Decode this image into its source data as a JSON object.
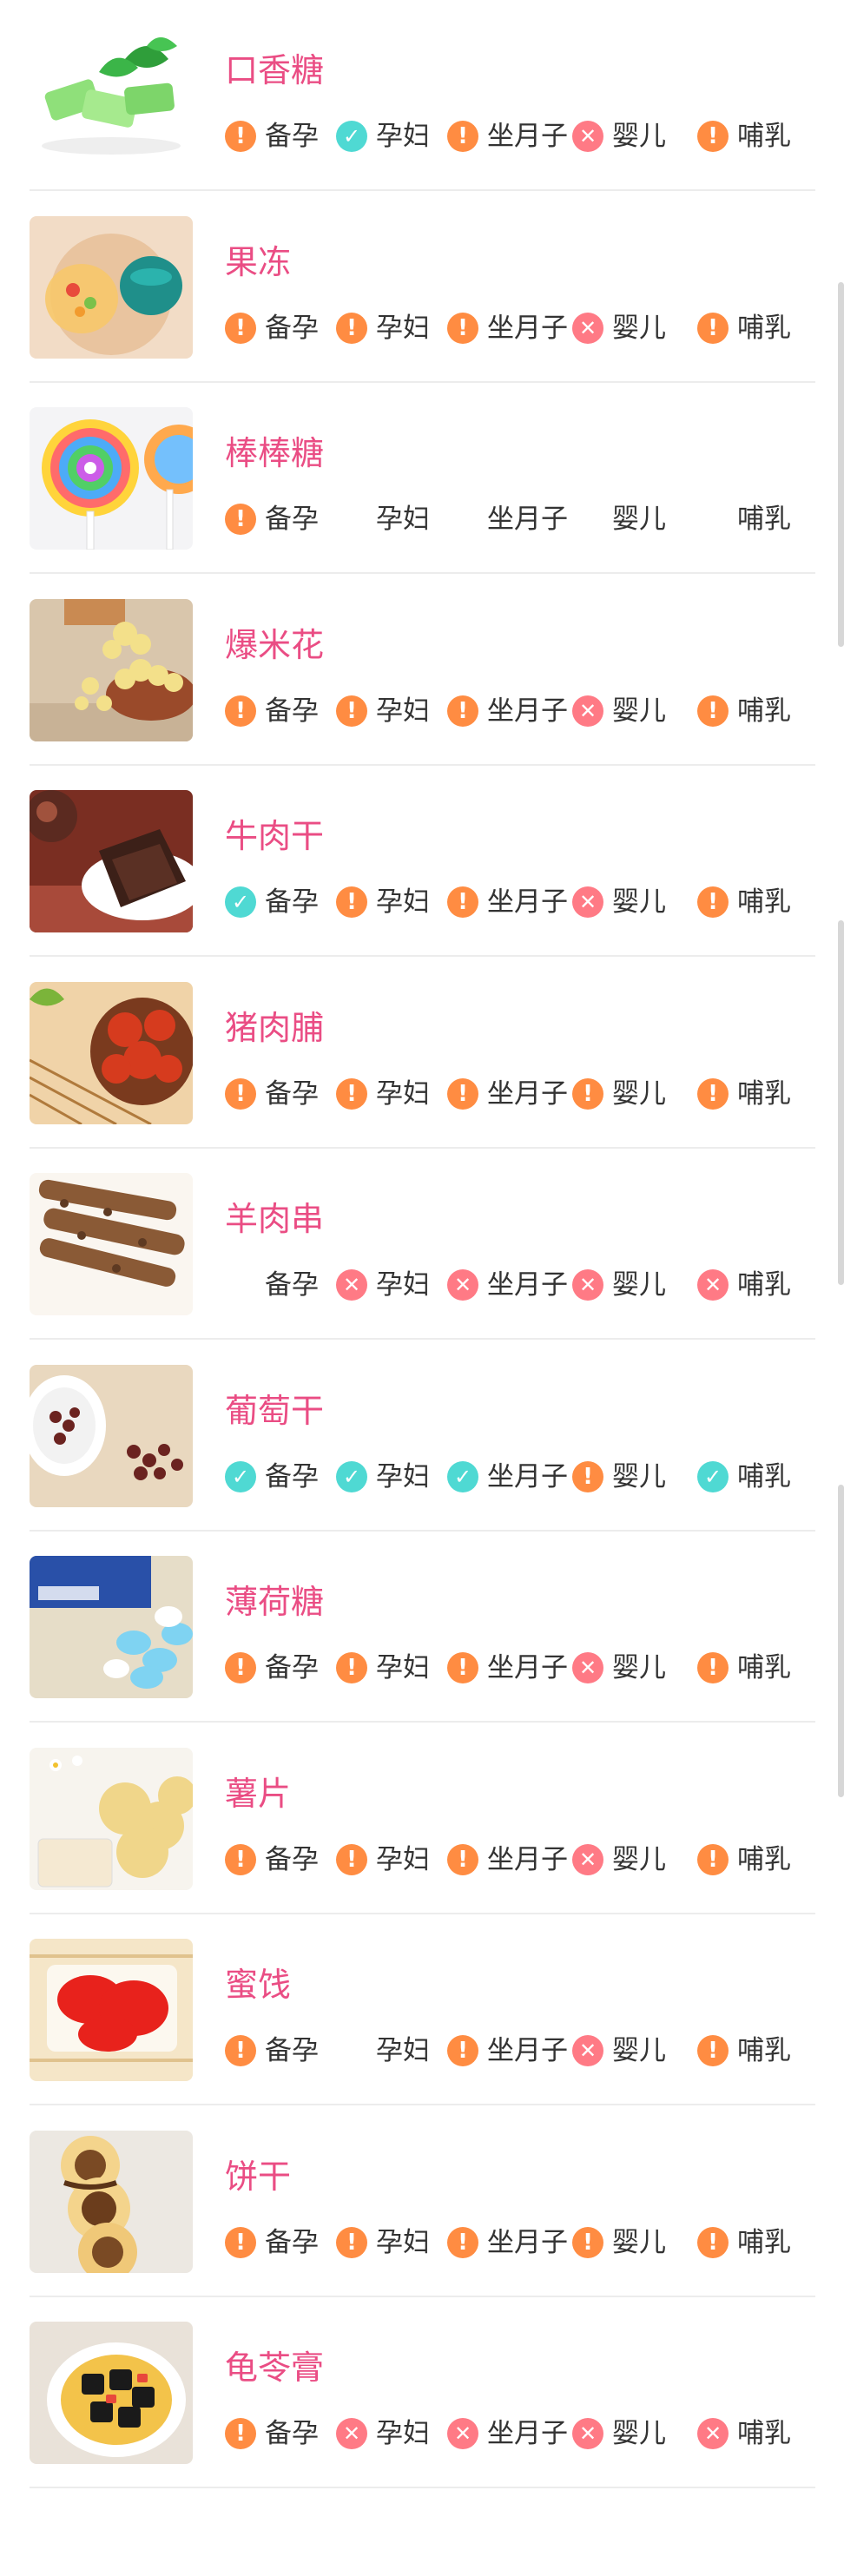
{
  "colors": {
    "name": "#ea4d84",
    "warn": "#ff8c42",
    "ok": "#4fd9d3",
    "no": "#ff7a85",
    "unknown": "#a99af2"
  },
  "status_icons": {
    "warn": "exclamation-icon",
    "ok": "check-icon",
    "no": "cross-icon",
    "unknown": "ellipsis-icon"
  },
  "tag_labels": [
    "备孕",
    "孕妇",
    "坐月子",
    "婴儿",
    "哺乳"
  ],
  "foods": [
    {
      "name": "口香糖",
      "image": "chewing-gum-image",
      "statuses": [
        "warn",
        "ok",
        "warn",
        "no",
        "warn"
      ]
    },
    {
      "name": "果冻",
      "image": "jelly-image",
      "statuses": [
        "warn",
        "warn",
        "warn",
        "no",
        "warn"
      ]
    },
    {
      "name": "棒棒糖",
      "image": "lollipop-image",
      "statuses": [
        "warn",
        "unknown",
        "unknown",
        "unknown",
        "unknown"
      ]
    },
    {
      "name": "爆米花",
      "image": "popcorn-image",
      "statuses": [
        "warn",
        "warn",
        "warn",
        "no",
        "warn"
      ]
    },
    {
      "name": "牛肉干",
      "image": "beef-jerky-image",
      "statuses": [
        "ok",
        "warn",
        "warn",
        "no",
        "warn"
      ]
    },
    {
      "name": "猪肉脯",
      "image": "pork-jerky-image",
      "statuses": [
        "warn",
        "warn",
        "warn",
        "warn",
        "warn"
      ]
    },
    {
      "name": "羊肉串",
      "image": "lamb-skewer-image",
      "statuses": [
        "unknown",
        "no",
        "no",
        "no",
        "no"
      ]
    },
    {
      "name": "葡萄干",
      "image": "raisins-image",
      "statuses": [
        "ok",
        "ok",
        "ok",
        "warn",
        "ok"
      ]
    },
    {
      "name": "薄荷糖",
      "image": "mint-candy-image",
      "statuses": [
        "warn",
        "warn",
        "warn",
        "no",
        "warn"
      ]
    },
    {
      "name": "薯片",
      "image": "potato-chips-image",
      "statuses": [
        "warn",
        "warn",
        "warn",
        "no",
        "warn"
      ]
    },
    {
      "name": "蜜饯",
      "image": "candied-fruit-image",
      "statuses": [
        "warn",
        "unknown",
        "warn",
        "no",
        "warn"
      ]
    },
    {
      "name": "饼干",
      "image": "biscuits-image",
      "statuses": [
        "warn",
        "warn",
        "warn",
        "warn",
        "warn"
      ]
    },
    {
      "name": "龟苓膏",
      "image": "herbal-jelly-image",
      "statuses": [
        "warn",
        "no",
        "no",
        "no",
        "no"
      ]
    }
  ]
}
